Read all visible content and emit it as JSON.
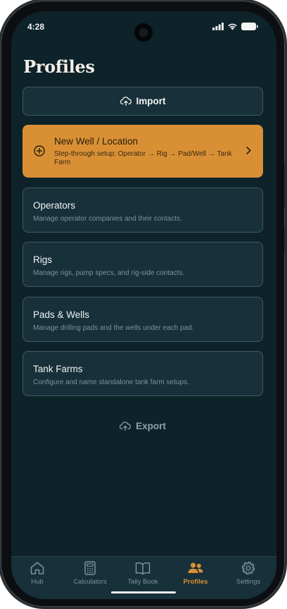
{
  "status": {
    "time": "4:28"
  },
  "header": {
    "title": "Profiles"
  },
  "actions": {
    "import_label": "Import",
    "export_label": "Export"
  },
  "primary_card": {
    "title": "New Well / Location",
    "subtitle": "Step-through setup: Operator → Rig → Pad/Well → Tank Farm"
  },
  "cards": [
    {
      "title": "Operators",
      "subtitle": "Manage operator companies and their contacts."
    },
    {
      "title": "Rigs",
      "subtitle": "Manage rigs, pump specs, and rig-side contacts."
    },
    {
      "title": "Pads & Wells",
      "subtitle": "Manage drilling pads and the wells under each pad."
    },
    {
      "title": "Tank Farms",
      "subtitle": "Configure and name standalone tank farm setups."
    }
  ],
  "tabs": [
    {
      "label": "Hub",
      "icon": "home-icon"
    },
    {
      "label": "Calculators",
      "icon": "calculator-icon"
    },
    {
      "label": "Tally Book",
      "icon": "book-icon"
    },
    {
      "label": "Profiles",
      "icon": "users-icon",
      "active": true
    },
    {
      "label": "Settings",
      "icon": "gear-icon"
    }
  ],
  "colors": {
    "accent": "#d99035",
    "background": "#0d2229",
    "surface": "#173039",
    "border": "#3f5c66"
  }
}
